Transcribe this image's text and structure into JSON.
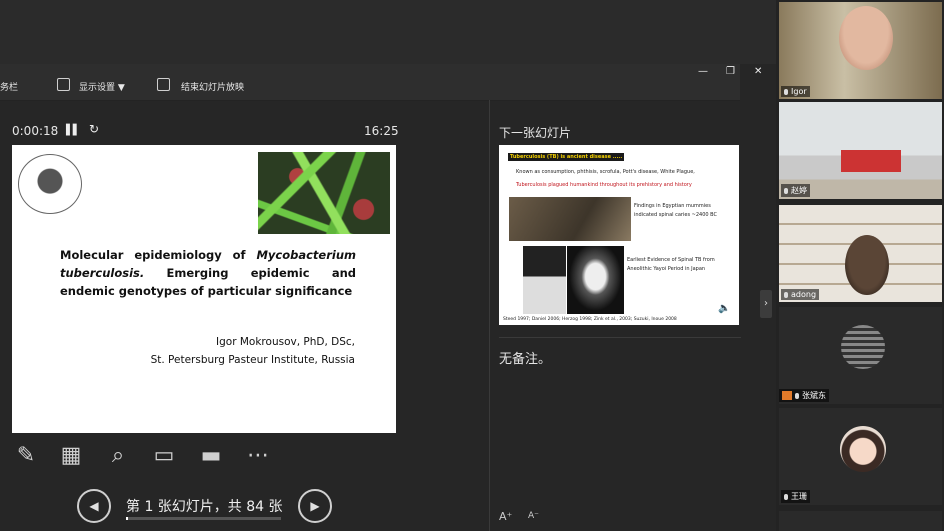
{
  "toolbar": {
    "taskbar_label": "务栏",
    "display_settings_label": "显示设置 ▼",
    "end_show_label": "结束幻灯片放映"
  },
  "presenter": {
    "elapsed_time": "0:00:18",
    "clock": "16:25",
    "slide_counter": "第 1 张幻灯片，共 84 张",
    "current_slide": 1,
    "total_slides": 84
  },
  "current_slide": {
    "title_part1": "Molecular epidemiology of ",
    "title_italic": "Mycobacterium tuberculosis.",
    "title_part2": " Emerging epidemic and endemic genotypes of particular significance",
    "author_line1": "Igor Mokrousov, PhD, DSc,",
    "author_line2": "St. Petersburg Pasteur Institute, Russia"
  },
  "next_slide": {
    "label": "下一张幻灯片",
    "banner": "Tuberculosis (TB) is ancient disease .....",
    "known_as": "Known as consumption, phthisis, scrofula, Pott's disease, White Plague,",
    "plagued": "Tuberculosis plagued humankind throughout its prehistory and history",
    "egypt": "Findings in Egyptian mummies",
    "egypt2": "indicated spinal caries ~2400 BC",
    "earliest": "Earliest Evidence of Spinal TB from",
    "earliest2": "Aneolithic Yayoi Period in Japan",
    "refs": "Steed 1997; Daniel 2006; Herzog 1998; Zink et al., 2003; Suzuki, Inoue 2008"
  },
  "notes": {
    "text": "无备注。"
  },
  "participants": [
    {
      "name": "Igor"
    },
    {
      "name": "赵婷"
    },
    {
      "name": "adong"
    },
    {
      "name": "张斌东"
    },
    {
      "name": "王珊"
    }
  ],
  "colors": {
    "accent_banner": "#1a1a1a",
    "banner_text": "#f5d100",
    "highlight_red": "#c0141c"
  }
}
